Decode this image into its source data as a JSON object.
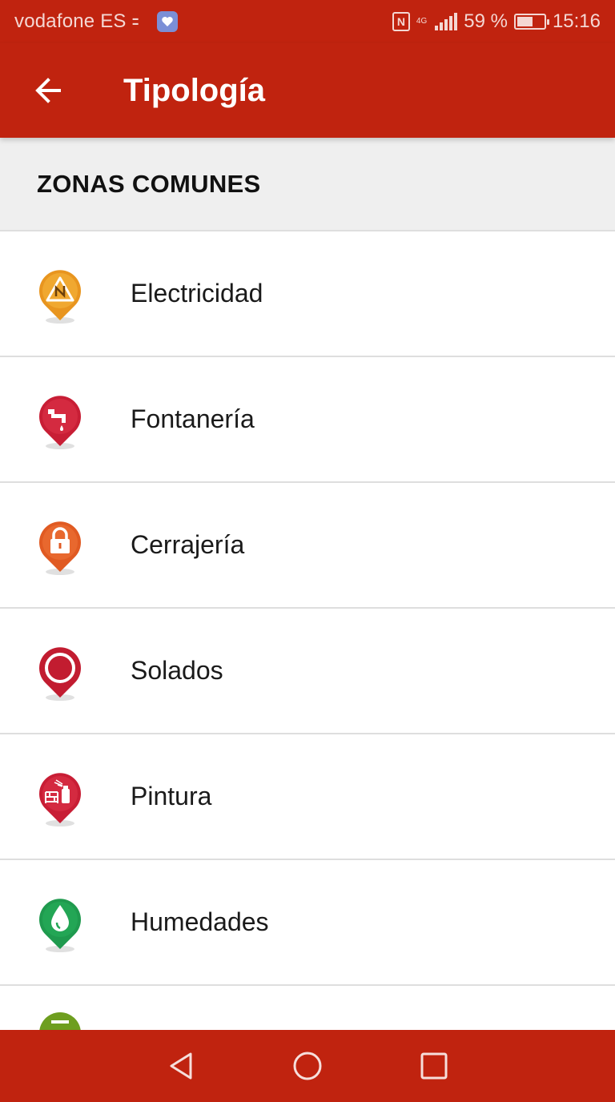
{
  "status_bar": {
    "carrier": "vodafone ES",
    "battery_percent_text": "59 %",
    "battery_level": 0.59,
    "network": "4G",
    "time": "15:16"
  },
  "app_bar": {
    "title": "Tipología"
  },
  "section": {
    "title": "ZONAS COMUNES"
  },
  "items": [
    {
      "label": "Electricidad",
      "icon": "electricity-icon",
      "color": "#e8951f"
    },
    {
      "label": "Fontanería",
      "icon": "faucet-icon",
      "color": "#c81e35"
    },
    {
      "label": "Cerrajería",
      "icon": "padlock-icon",
      "color": "#e05a22"
    },
    {
      "label": "Solados",
      "icon": "floor-circle-icon",
      "color": "#c21c30"
    },
    {
      "label": "Pintura",
      "icon": "paint-spray-icon",
      "color": "#c81e35"
    },
    {
      "label": "Humedades",
      "icon": "water-drop-icon",
      "color": "#1f9a4e"
    }
  ],
  "colors": {
    "primary": "#c0230f",
    "section_bg": "#efefef",
    "divider": "#dedede",
    "partial_icon": "#6e9e1f"
  }
}
